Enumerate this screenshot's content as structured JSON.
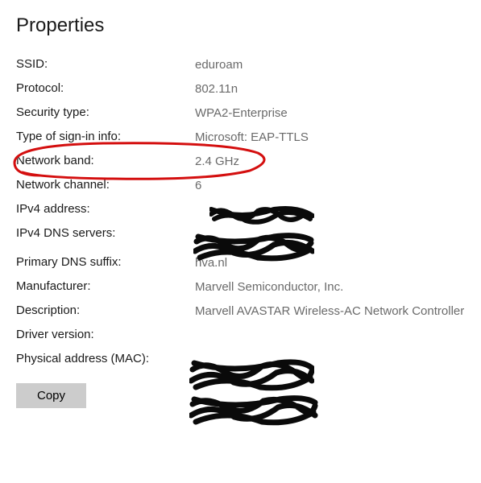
{
  "title": "Properties",
  "rows": {
    "ssid": {
      "label": "SSID:",
      "value": "eduroam"
    },
    "protocol": {
      "label": "Protocol:",
      "value": "802.11n"
    },
    "security_type": {
      "label": "Security type:",
      "value": "WPA2-Enterprise"
    },
    "signin_info": {
      "label": "Type of sign-in info:",
      "value": "Microsoft: EAP-TTLS"
    },
    "network_band": {
      "label": "Network band:",
      "value": "2.4 GHz"
    },
    "network_channel": {
      "label": "Network channel:",
      "value": "6"
    },
    "ipv4_address": {
      "label": "IPv4 address:",
      "value": ""
    },
    "ipv4_dns": {
      "label": "IPv4 DNS servers:",
      "value": ""
    },
    "primary_dns_suffix": {
      "label": "Primary DNS suffix:",
      "value": "hva.nl"
    },
    "manufacturer": {
      "label": "Manufacturer:",
      "value": "Marvell Semiconductor, Inc."
    },
    "description": {
      "label": "Description:",
      "value": "Marvell AVASTAR Wireless-AC Network Controller"
    },
    "driver_version": {
      "label": "Driver version:",
      "value": ""
    },
    "physical_address": {
      "label": "Physical address (MAC):",
      "value": ""
    }
  },
  "copy_button": "Copy",
  "annotations": {
    "circled_row": "network_band",
    "redacted_rows": [
      "ipv4_address",
      "ipv4_dns",
      "driver_version",
      "physical_address"
    ]
  },
  "colors": {
    "annotation_red": "#d40f0f",
    "redaction_black": "#0a0a0a",
    "button_bg": "#cccccc"
  }
}
